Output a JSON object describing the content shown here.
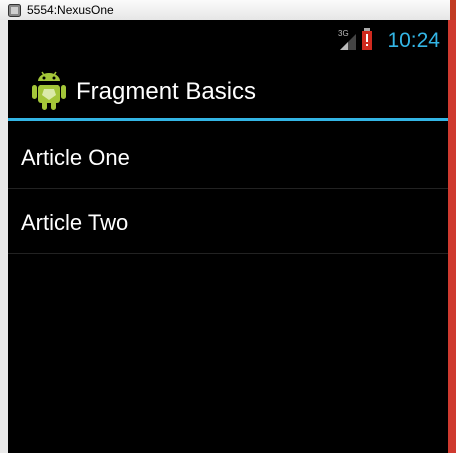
{
  "window": {
    "title": "5554:NexusOne"
  },
  "statusbar": {
    "time": "10:24",
    "network_type": "3G",
    "icons": [
      "signal-icon",
      "battery-alert-icon"
    ],
    "accent_color": "#33b5e5"
  },
  "actionbar": {
    "title": "Fragment Basics",
    "icon": "android-app-icon"
  },
  "list": {
    "items": [
      {
        "label": "Article One"
      },
      {
        "label": "Article Two"
      }
    ]
  }
}
